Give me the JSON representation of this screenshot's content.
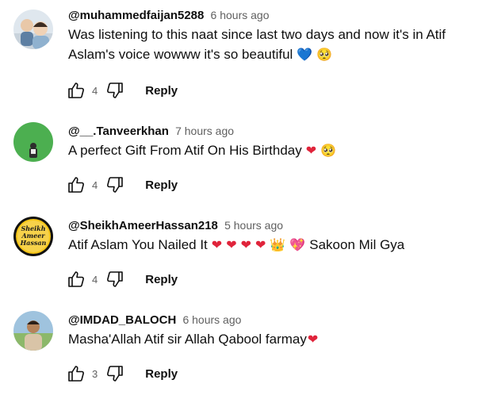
{
  "comments": [
    {
      "author": "@muhammedfaijan5288",
      "time": "6 hours ago",
      "text": "Was listening to this naat since last two days and now it's in Atif Aslam's voice wowww it's so beautiful",
      "emojis": [
        "💙",
        "🥺"
      ],
      "likes": "4",
      "reply_label": "Reply"
    },
    {
      "author": "@__.Tanveerkhan",
      "time": "7 hours ago",
      "text": "A perfect Gift From Atif On His Birthday",
      "emojis": [
        "❤",
        "🥺"
      ],
      "likes": "4",
      "reply_label": "Reply"
    },
    {
      "author": "@SheikhAmeerHassan218",
      "time": "5 hours ago",
      "text": "Atif Aslam You Nailed It",
      "emojis": [
        "❤",
        "❤",
        "❤",
        "❤",
        "👑",
        "💖"
      ],
      "text_tail": "Sakoon Mil Gya",
      "avatar_text": [
        "Sheikh",
        "Ameer",
        "Hassan"
      ],
      "likes": "4",
      "reply_label": "Reply"
    },
    {
      "author": "@IMDAD_BALOCH",
      "time": "6 hours ago",
      "text": "Masha'Allah Atif sir Allah Qabool farmay",
      "emojis": [
        "❤"
      ],
      "likes": "3",
      "reply_label": "Reply"
    }
  ],
  "icons": {
    "like": "thumbs-up-icon",
    "dislike": "thumbs-down-icon"
  },
  "colors": {
    "text": "#0f0f0f",
    "secondary": "#606060",
    "heart": "#e0243b",
    "blue_heart": "#3a87e0",
    "avatar2_bg": "#4caf50",
    "avatar3_bg": "#111111",
    "avatar3_text": "#f5c518"
  }
}
